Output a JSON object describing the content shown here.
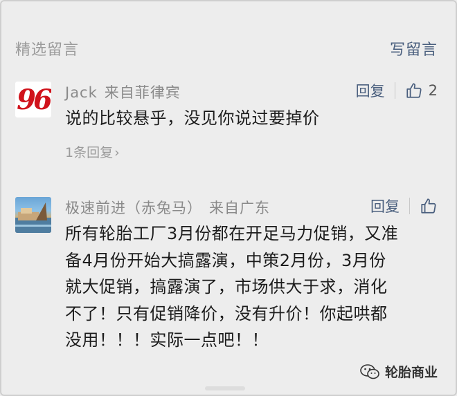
{
  "header": {
    "title": "精选留言",
    "write_label": "写留言"
  },
  "comments": [
    {
      "nickname": "Jack",
      "location": "来自菲律宾",
      "avatar_text": "96",
      "reply_label": "回复",
      "likes": "2",
      "content": "说的比较悬乎，没见你说过要掉价",
      "sub_replies": "1条回复",
      "sub_chevron": "›"
    },
    {
      "nickname": "极速前进（赤兔马）",
      "location": "来自广东",
      "reply_label": "回复",
      "content_lines": [
        "所有轮胎工厂3月份都在开足马力促销，又准",
        "备4月份开始大搞露演，中策2月份，3月份",
        "就大促销，搞露演了，市场供大于求，消化",
        "不了！只有促销降价，没有升价！你起哄都",
        "没用！！！实际一点吧！！"
      ]
    }
  ],
  "watermark": {
    "text": "轮胎商业"
  },
  "colors": {
    "background": "#ededed",
    "link": "#4a5f7e",
    "muted": "#9b9b9b",
    "text": "#1c1c1c",
    "brand_red": "#d0121b"
  }
}
